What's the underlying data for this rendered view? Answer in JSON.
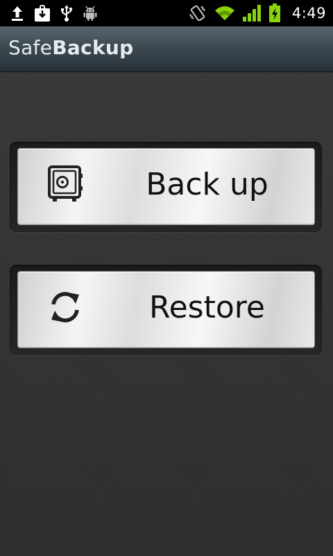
{
  "status_bar": {
    "left_icons": [
      "upload-icon",
      "download-icon",
      "usb-icon",
      "android-debug-icon"
    ],
    "right_icons": [
      "vibrate-icon",
      "wifi-icon",
      "signal-icon",
      "battery-charging-icon"
    ],
    "time": "4:49",
    "battery_color": "#8ad40c",
    "signal_color": "#8ad40c"
  },
  "title_bar": {
    "title_regular": "Safe",
    "title_bold": "Backup"
  },
  "actions": {
    "backup": {
      "label": "Back up",
      "icon": "safe-vault-icon"
    },
    "restore": {
      "label": "Restore",
      "icon": "sync-arrows-icon"
    }
  }
}
